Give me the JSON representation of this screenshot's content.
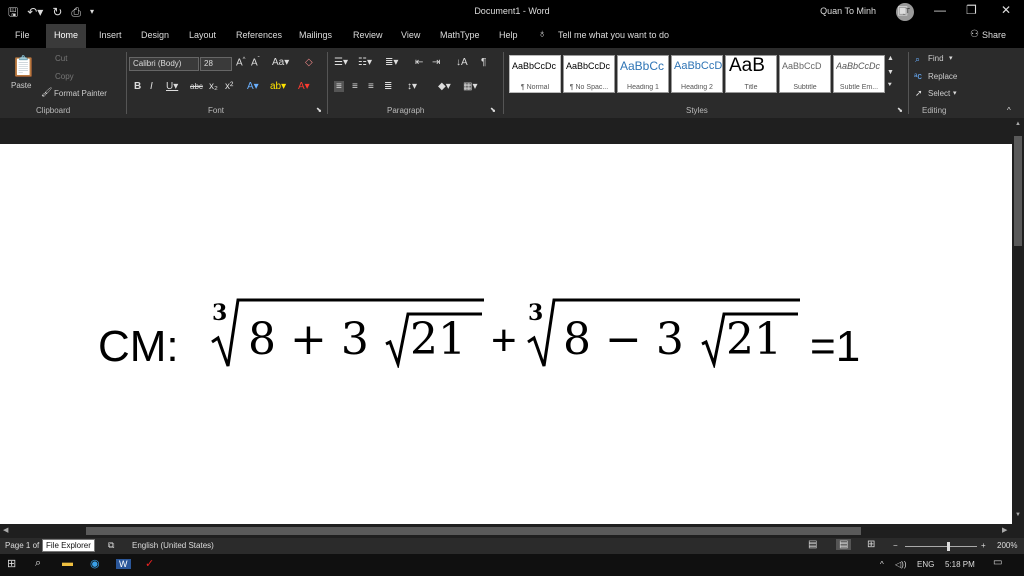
{
  "titlebar": {
    "title": "Document1 - Word",
    "user": "Quan To Minh",
    "avatar": "QT",
    "icons": [
      "save-icon",
      "undo-icon",
      "redo-icon",
      "print-preview-icon",
      "customize-qat-icon"
    ],
    "window_buttons": [
      "ribbon-display-icon",
      "minimize-icon",
      "restore-icon",
      "close-icon"
    ]
  },
  "tabs": {
    "items": [
      "File",
      "Home",
      "Insert",
      "Design",
      "Layout",
      "References",
      "Mailings",
      "Review",
      "View",
      "MathType",
      "Help"
    ],
    "active": "Home",
    "tell_me": "Tell me what you want to do",
    "share": "Share"
  },
  "ribbon": {
    "clipboard": {
      "paste": "Paste",
      "cut": "Cut",
      "copy": "Copy",
      "format_painter": "Format Painter",
      "label": "Clipboard"
    },
    "font": {
      "font_name": "Calibri (Body)",
      "font_size": "28",
      "label": "Font"
    },
    "paragraph": {
      "label": "Paragraph"
    },
    "styles": {
      "label": "Styles",
      "items": [
        {
          "preview": "AaBbCcDc",
          "name": "¶ Normal"
        },
        {
          "preview": "AaBbCcDc",
          "name": "¶ No Spac..."
        },
        {
          "preview": "AaBbCc",
          "name": "Heading 1"
        },
        {
          "preview": "AaBbCcD",
          "name": "Heading 2"
        },
        {
          "preview": "AaB",
          "name": "Title"
        },
        {
          "preview": "AaBbCcD",
          "name": "Subtitle"
        },
        {
          "preview": "AaBbCcDc",
          "name": "Subtle Em..."
        }
      ]
    },
    "editing": {
      "find": "Find",
      "replace": "Replace",
      "select": "Select",
      "label": "Editing"
    }
  },
  "document": {
    "prefix": "CM:",
    "term1": {
      "index": "3",
      "inner_lead": "8 + 3",
      "inner_root": "21"
    },
    "plus": "+",
    "term2": {
      "index": "3",
      "inner_lead": "8 − 3",
      "inner_root": "21"
    },
    "suffix": "=1"
  },
  "statusbar": {
    "page": "Page 1 of",
    "tooltip": "File Explorer",
    "language": "English (United States)",
    "zoom": "200%"
  },
  "taskbar": {
    "lang": "ENG",
    "time": "5:18 PM"
  },
  "colors": {
    "ribbon_bg": "#2b2b2b",
    "title_bg": "#000000",
    "page_bg": "#ffffff"
  }
}
